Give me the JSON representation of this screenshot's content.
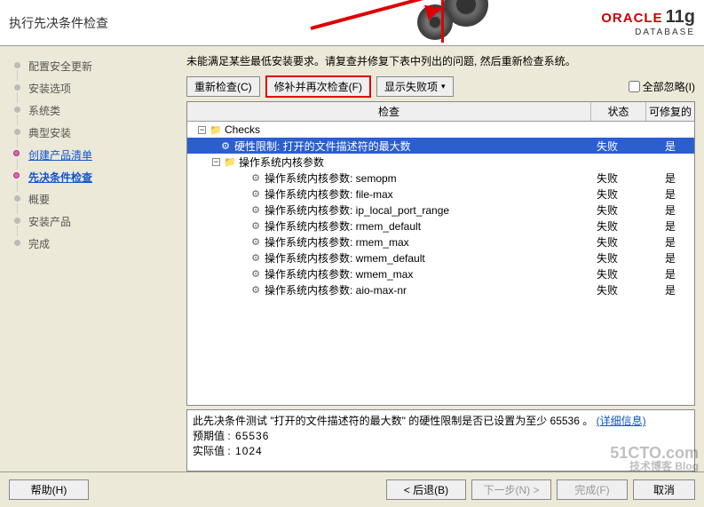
{
  "header": {
    "title": "执行先决条件检查",
    "brand": "ORACLE",
    "brand_sub": "DATABASE",
    "brand_ver": "11g"
  },
  "nav": {
    "items": [
      {
        "label": "配置安全更新",
        "link": false
      },
      {
        "label": "安装选项",
        "link": false
      },
      {
        "label": "系统类",
        "link": false
      },
      {
        "label": "典型安装",
        "link": false
      },
      {
        "label": "创建产品清单",
        "link": true
      },
      {
        "label": "先决条件检查",
        "current": true
      },
      {
        "label": "概要",
        "link": false
      },
      {
        "label": "安装产品",
        "link": false
      },
      {
        "label": "完成",
        "link": false
      }
    ]
  },
  "content": {
    "message": "未能满足某些最低安装要求。请复查并修复下表中列出的问题, 然后重新检查系统。",
    "btn_recheck": "重新检查(C)",
    "btn_fix": "修补并再次检查(F)",
    "btn_showfail": "显示失败项",
    "chk_ignore": "全部忽略(I)"
  },
  "cols": {
    "check": "检查",
    "status": "状态",
    "fixable": "可修复的"
  },
  "tree": {
    "root": "Checks",
    "selected": {
      "label": "硬性限制: 打开的文件描述符的最大数",
      "status": "失败",
      "fix": "是"
    },
    "group": "操作系统内核参数",
    "children": [
      {
        "label": "操作系统内核参数: semopm",
        "status": "失败",
        "fix": "是"
      },
      {
        "label": "操作系统内核参数: file-max",
        "status": "失败",
        "fix": "是"
      },
      {
        "label": "操作系统内核参数: ip_local_port_range",
        "status": "失败",
        "fix": "是"
      },
      {
        "label": "操作系统内核参数: rmem_default",
        "status": "失败",
        "fix": "是"
      },
      {
        "label": "操作系统内核参数: rmem_max",
        "status": "失败",
        "fix": "是"
      },
      {
        "label": "操作系统内核参数: wmem_default",
        "status": "失败",
        "fix": "是"
      },
      {
        "label": "操作系统内核参数: wmem_max",
        "status": "失败",
        "fix": "是"
      },
      {
        "label": "操作系统内核参数: aio-max-nr",
        "status": "失败",
        "fix": "是"
      }
    ]
  },
  "detail": {
    "text": "此先决条件测试 \"打开的文件描述符的最大数\" 的硬性限制是否已设置为至少 65536 。",
    "link": "(详细信息)",
    "expected_lbl": "预期值",
    "expected_val": ": 65536",
    "actual_lbl": "实际值",
    "actual_val": ": 1024"
  },
  "footer": {
    "help": "帮助(H)",
    "back": "< 后退(B)",
    "next": "下一步(N) >",
    "finish": "完成(F)",
    "cancel": "取消"
  },
  "watermark": {
    "top": "51CTO.com",
    "bot": "技术博客  Blog"
  }
}
